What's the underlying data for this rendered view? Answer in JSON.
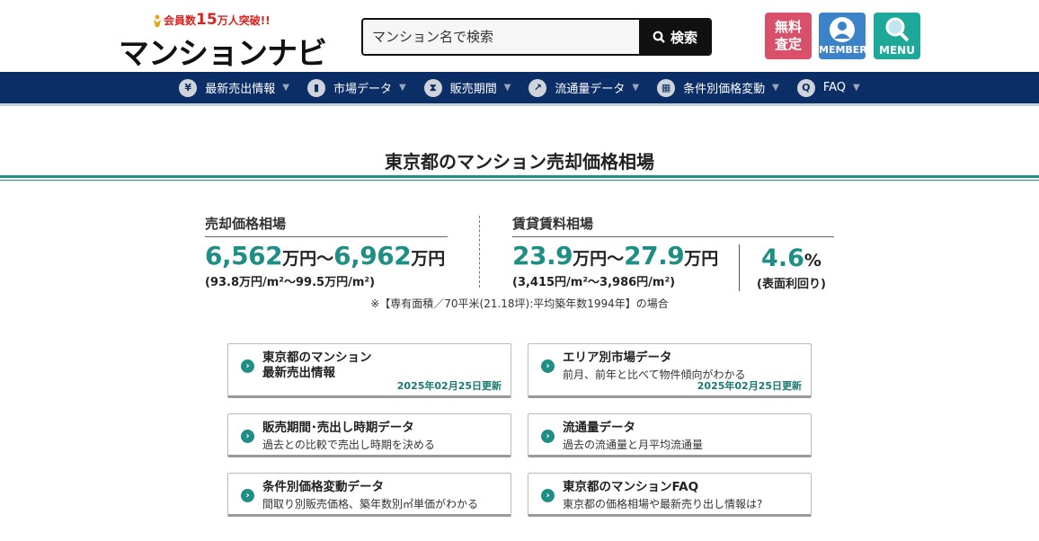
{
  "header": {
    "logo_tagline_prefix": "会員数",
    "logo_tagline_number": "15",
    "logo_tagline_suffix": "万人突破!!",
    "logo_name": "マンションナビ",
    "search_placeholder": "マンション名で検索",
    "search_button": "検索",
    "satei_line1": "無料",
    "satei_line2": "査定",
    "member_label": "MEMBER",
    "menu_label": "MENU"
  },
  "nav": {
    "items": [
      {
        "icon": "¥",
        "label": "最新売出情報"
      },
      {
        "icon": "▮",
        "label": "市場データ"
      },
      {
        "icon": "⧗",
        "label": "販売期間"
      },
      {
        "icon": "↗",
        "label": "流通量データ"
      },
      {
        "icon": "▦",
        "label": "条件別価格変動"
      },
      {
        "icon": "Q",
        "label": "FAQ"
      }
    ],
    "arrow": "▼"
  },
  "page_title": "東京都のマンション売却価格相場",
  "sale": {
    "label": "売却価格相場",
    "low": "6,562",
    "high": "6,962",
    "unit": "万円",
    "tilde": "〜",
    "per_sqm": "(93.8万円/m²〜99.5万円/m²)"
  },
  "rent": {
    "label": "賃貸賃料相場",
    "low": "23.9",
    "high": "27.9",
    "unit": "万円",
    "tilde": "〜",
    "per_sqm": "(3,415円/m²〜3,986円/m²)",
    "yield_value": "4.6",
    "yield_unit": "%",
    "yield_label": "(表面利回り)"
  },
  "note": "※【専有面積／70平米(21.18坪):平均築年数1994年】の場合",
  "cards": [
    {
      "title1": "東京都のマンション",
      "title2": "最新売出情報",
      "desc": "",
      "date": "2025年02月25日更新"
    },
    {
      "title1": "エリア別市場データ",
      "title2": "",
      "desc": "前月、前年と比べて物件傾向がわかる",
      "date": "2025年02月25日更新"
    },
    {
      "title1": "販売期間･売出し時期データ",
      "title2": "",
      "desc": "過去との比較で売出し時期を決める",
      "date": ""
    },
    {
      "title1": "流通量データ",
      "title2": "",
      "desc": "過去の流通量と月平均流通量",
      "date": ""
    },
    {
      "title1": "条件別価格変動データ",
      "title2": "",
      "desc": "間取り別販売価格、築年数別㎡単価がわかる",
      "date": ""
    },
    {
      "title1": "東京都のマンションFAQ",
      "title2": "",
      "desc": "東京都の価格相場や最新売り出し情報は?",
      "date": ""
    }
  ],
  "card_arrow": "›",
  "colors": {
    "accent": "#1f8f86",
    "nav": "#0b2e66",
    "satei": "#d8506a",
    "member": "#3b82c8",
    "menu": "#1ea89a"
  }
}
